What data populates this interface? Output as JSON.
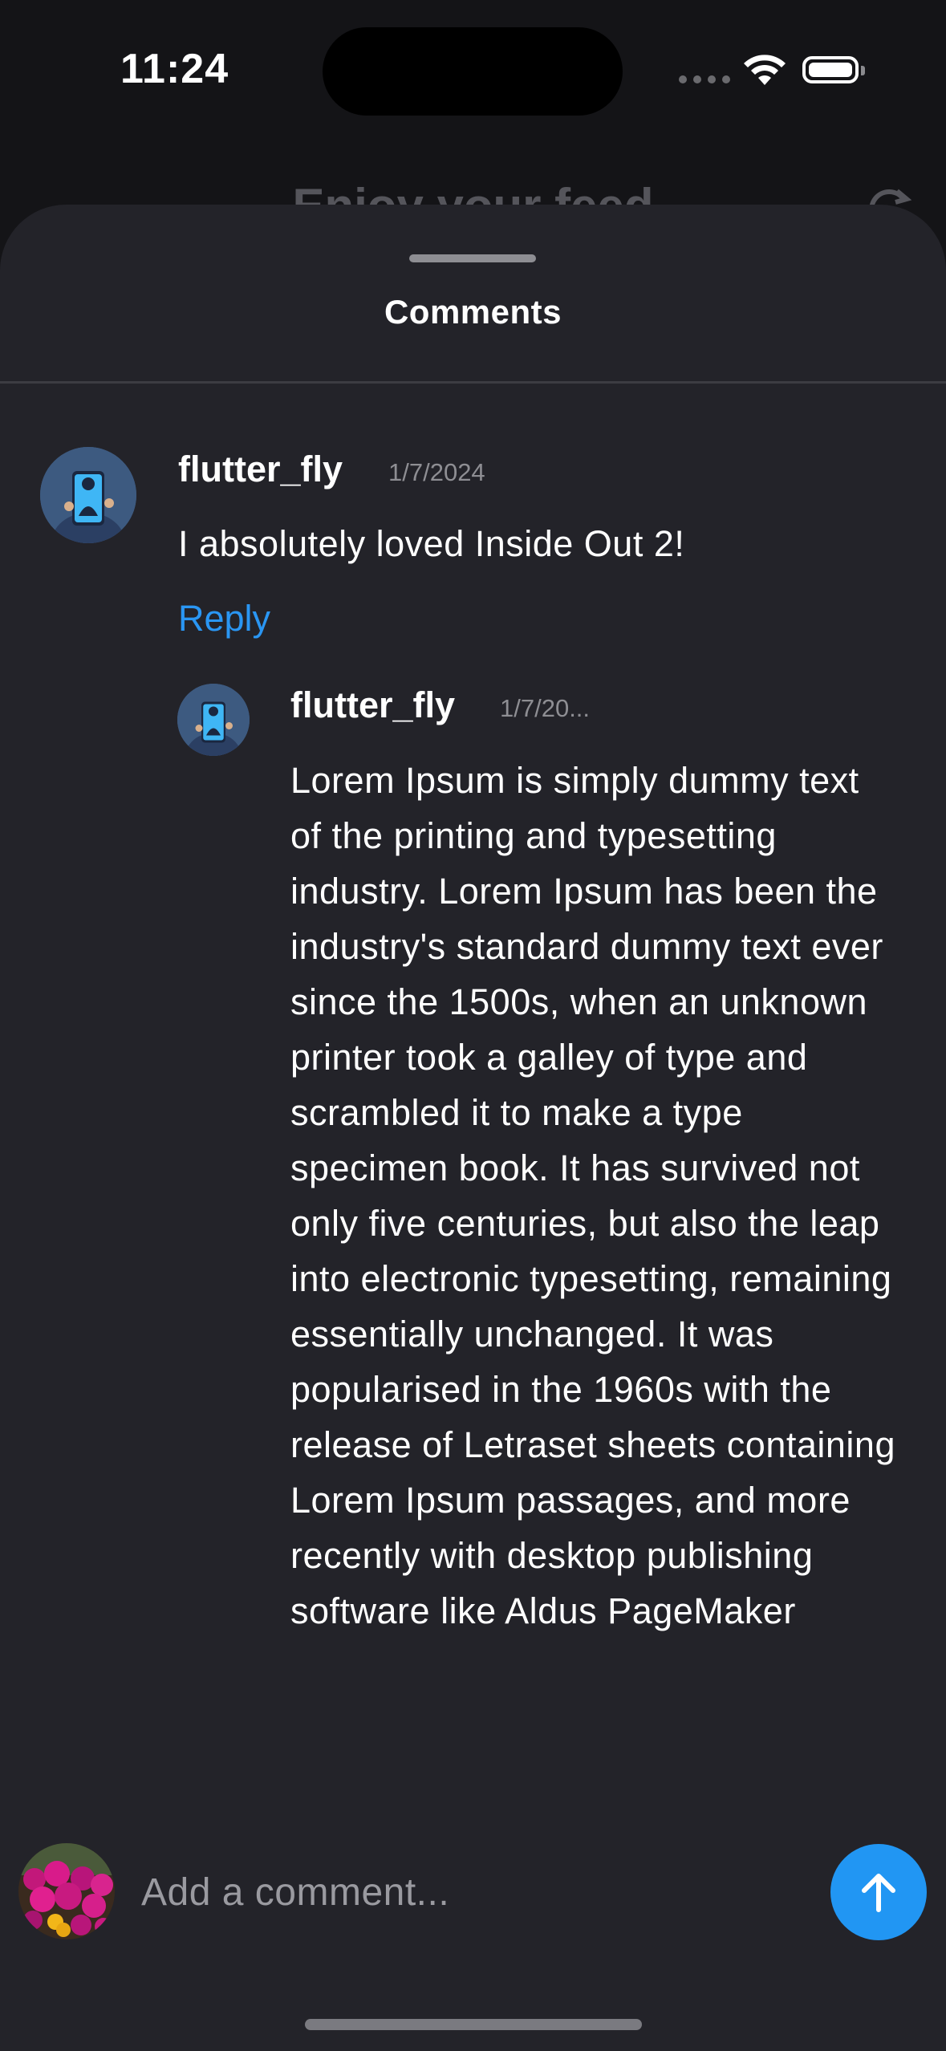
{
  "status_bar": {
    "time": "11:24"
  },
  "background": {
    "title": "Enjoy your feed"
  },
  "sheet": {
    "title": "Comments"
  },
  "comments": [
    {
      "username": "flutter_fly",
      "date": "1/7/2024",
      "text": "I absolutely loved Inside Out 2!",
      "reply_label": "Reply"
    }
  ],
  "replies": [
    {
      "username": "flutter_fly",
      "date": "1/7/20...",
      "text": "Lorem Ipsum is simply dummy text of the printing and typesetting industry. Lorem Ipsum has been the industry's standard dummy text ever since the 1500s, when an unknown printer took a galley of type and scrambled it to make a type specimen book. It has survived not only five centuries, but also the leap into electronic typesetting, remaining essentially unchanged. It was popularised in the 1960s with the release of Letraset sheets containing Lorem Ipsum passages, and more recently with desktop publishing software like Aldus PageMaker"
    }
  ],
  "composer": {
    "placeholder": "Add a comment...",
    "send_icon": "arrow-up-icon"
  },
  "colors": {
    "sheet_background": "#232329",
    "accent": "#2196f3",
    "reply_link": "#2a96f3"
  }
}
